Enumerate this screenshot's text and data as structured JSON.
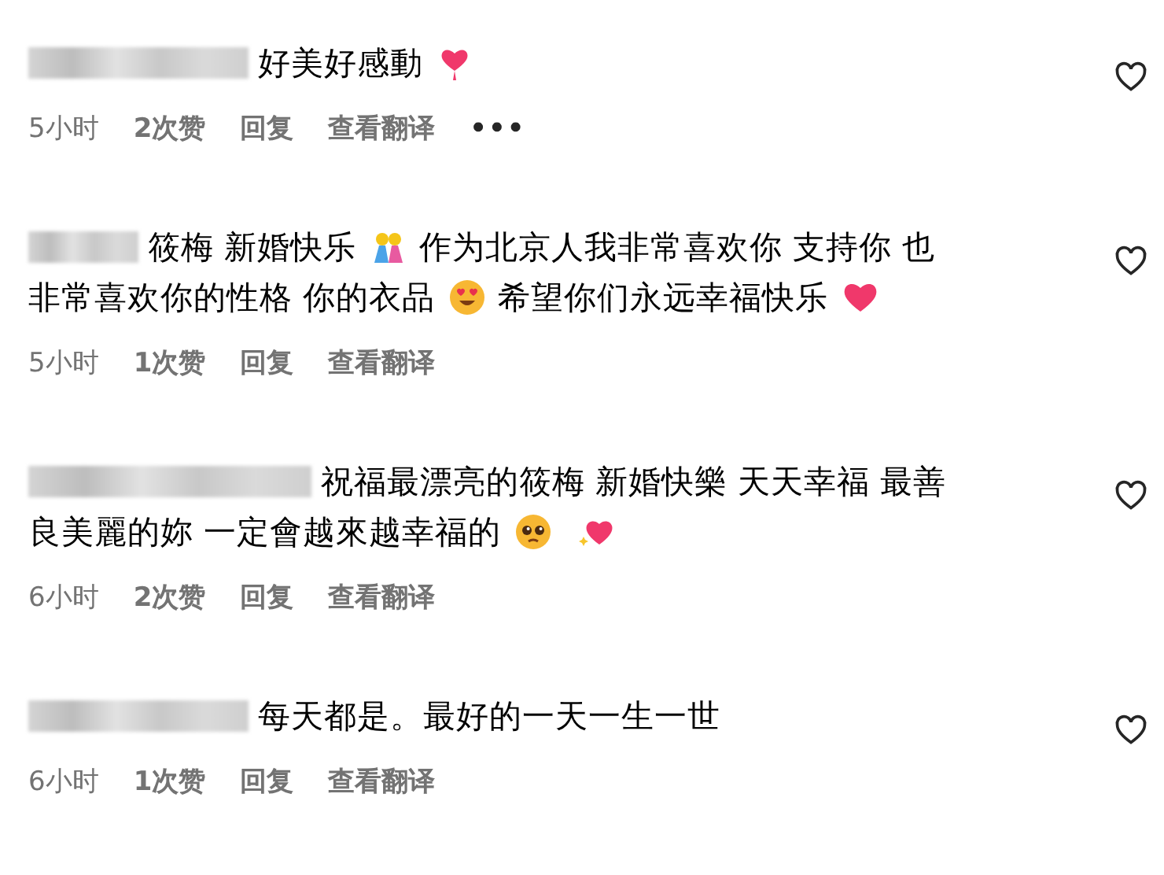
{
  "comments": [
    {
      "lines": [
        [
          {
            "kind": "text",
            "text": "好美好感動"
          },
          {
            "kind": "heart-balloon"
          }
        ]
      ],
      "meta": {
        "time": "5小时",
        "likes": "2次赞",
        "reply": "回复",
        "translate": "查看翻译",
        "more": "•••"
      }
    },
    {
      "lines": [
        [
          {
            "kind": "text",
            "text": "筱梅 新婚快乐"
          },
          {
            "kind": "couple"
          },
          {
            "kind": "text",
            "text": "作为北京人我非常喜欢你 支持你 也"
          }
        ],
        [
          {
            "kind": "text",
            "text": "非常喜欢你的性格 你的衣品"
          },
          {
            "kind": "heart-eyes"
          },
          {
            "kind": "text",
            "text": "希望你们永远幸福快乐"
          },
          {
            "kind": "heart"
          }
        ]
      ],
      "meta": {
        "time": "5小时",
        "likes": "1次赞",
        "reply": "回复",
        "translate": "查看翻译"
      }
    },
    {
      "lines": [
        [
          {
            "kind": "text",
            "text": "祝福最漂亮的筱梅 新婚快樂 天天幸福 最善"
          }
        ],
        [
          {
            "kind": "text",
            "text": "良美麗的妳 一定會越來越幸福的"
          },
          {
            "kind": "pleading"
          },
          {
            "kind": "sparkle-heart"
          }
        ]
      ],
      "meta": {
        "time": "6小时",
        "likes": "2次赞",
        "reply": "回复",
        "translate": "查看翻译"
      }
    },
    {
      "lines": [
        [
          {
            "kind": "text",
            "text": "每天都是。最好的一天一生一世"
          }
        ]
      ],
      "meta": {
        "time": "6小时",
        "likes": "1次赞",
        "reply": "回复",
        "translate": "查看翻译"
      }
    }
  ]
}
